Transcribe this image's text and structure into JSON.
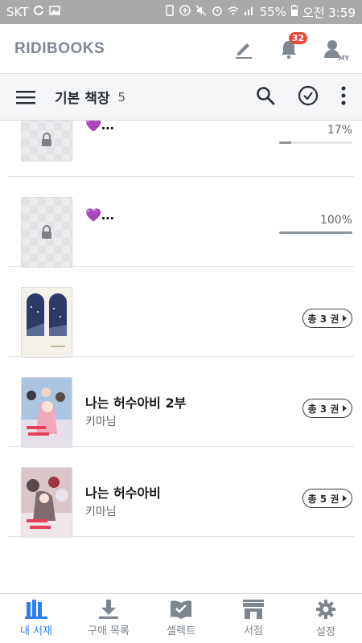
{
  "status": {
    "carrier": "SKT",
    "battery": "55%",
    "time": "오전 3:59"
  },
  "header": {
    "logo": "RIDIBOOKS",
    "notification_count": "32",
    "my_label": "MY"
  },
  "shelf": {
    "title": "기본 책장",
    "count": "5"
  },
  "books": [
    {
      "title": "💜…",
      "percent_label": "17%",
      "progress": 0.17
    },
    {
      "title": "💜…",
      "percent_label": "100%",
      "progress": 1.0
    },
    {
      "series_label": "총 3 권"
    },
    {
      "title": "나는 허수아비 2부",
      "author": "키마님",
      "series_label": "총 3 권"
    },
    {
      "title": "나는 허수아비",
      "author": "키마님",
      "series_label": "총 5 권"
    }
  ],
  "nav": {
    "items": [
      {
        "label": "내 서재",
        "icon": "library-icon",
        "active": true
      },
      {
        "label": "구매 목록",
        "icon": "download-icon",
        "active": false
      },
      {
        "label": "셀렉트",
        "icon": "select-icon",
        "active": false
      },
      {
        "label": "서점",
        "icon": "store-icon",
        "active": false
      },
      {
        "label": "설정",
        "icon": "settings-icon",
        "active": false
      }
    ]
  },
  "colors": {
    "accent": "#2e7ef2",
    "badge": "#e64938",
    "status_bar": "#a9a9ab"
  }
}
